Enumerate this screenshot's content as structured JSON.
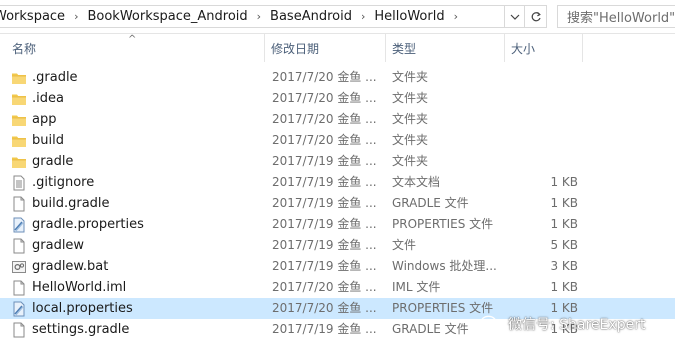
{
  "address": {
    "crumbs": [
      "Workspace",
      "BookWorkspace_Android",
      "BaseAndroid",
      "HelloWorld"
    ],
    "separator": "›",
    "search_placeholder": "搜索\"HelloWorld\""
  },
  "columns": {
    "name": "名称",
    "date": "修改日期",
    "type": "类型",
    "size": "大小",
    "sort_indicator": "^"
  },
  "files": [
    {
      "name": ".gradle",
      "date": "2017/7/20 金鱼 ...",
      "type": "文件夹",
      "size": "",
      "icon": "folder-icon"
    },
    {
      "name": ".idea",
      "date": "2017/7/20 金鱼 ...",
      "type": "文件夹",
      "size": "",
      "icon": "folder-icon"
    },
    {
      "name": "app",
      "date": "2017/7/20 金鱼 ...",
      "type": "文件夹",
      "size": "",
      "icon": "folder-icon"
    },
    {
      "name": "build",
      "date": "2017/7/20 金鱼 ...",
      "type": "文件夹",
      "size": "",
      "icon": "folder-icon"
    },
    {
      "name": "gradle",
      "date": "2017/7/19 金鱼 ...",
      "type": "文件夹",
      "size": "",
      "icon": "folder-icon"
    },
    {
      "name": ".gitignore",
      "date": "2017/7/19 金鱼 ...",
      "type": "文本文档",
      "size": "1 KB",
      "icon": "text-document-icon"
    },
    {
      "name": "build.gradle",
      "date": "2017/7/19 金鱼 ...",
      "type": "GRADLE 文件",
      "size": "1 KB",
      "icon": "blank-file-icon"
    },
    {
      "name": "gradle.properties",
      "date": "2017/7/19 金鱼 ...",
      "type": "PROPERTIES 文件",
      "size": "1 KB",
      "icon": "properties-file-icon"
    },
    {
      "name": "gradlew",
      "date": "2017/7/19 金鱼 ...",
      "type": "文件",
      "size": "5 KB",
      "icon": "blank-file-icon"
    },
    {
      "name": "gradlew.bat",
      "date": "2017/7/19 金鱼 ...",
      "type": "Windows 批处理...",
      "size": "3 KB",
      "icon": "batch-file-icon"
    },
    {
      "name": "HelloWorld.iml",
      "date": "2017/7/20 金鱼 ...",
      "type": "IML 文件",
      "size": "1 KB",
      "icon": "blank-file-icon"
    },
    {
      "name": "local.properties",
      "date": "2017/7/20 金鱼 ...",
      "type": "PROPERTIES 文件",
      "size": "1 KB",
      "icon": "properties-file-icon",
      "selected": true
    },
    {
      "name": "settings.gradle",
      "date": "2017/7/19 金鱼 ...",
      "type": "GRADLE 文件",
      "size": "1 KB",
      "icon": "blank-file-icon"
    }
  ],
  "watermark": {
    "text": "微信号: ShareExpert",
    "icon": "wechat-icon"
  },
  "colors": {
    "selected_row": "#cce8ff",
    "folder": "#f8d775",
    "header_text": "#4c607a"
  }
}
